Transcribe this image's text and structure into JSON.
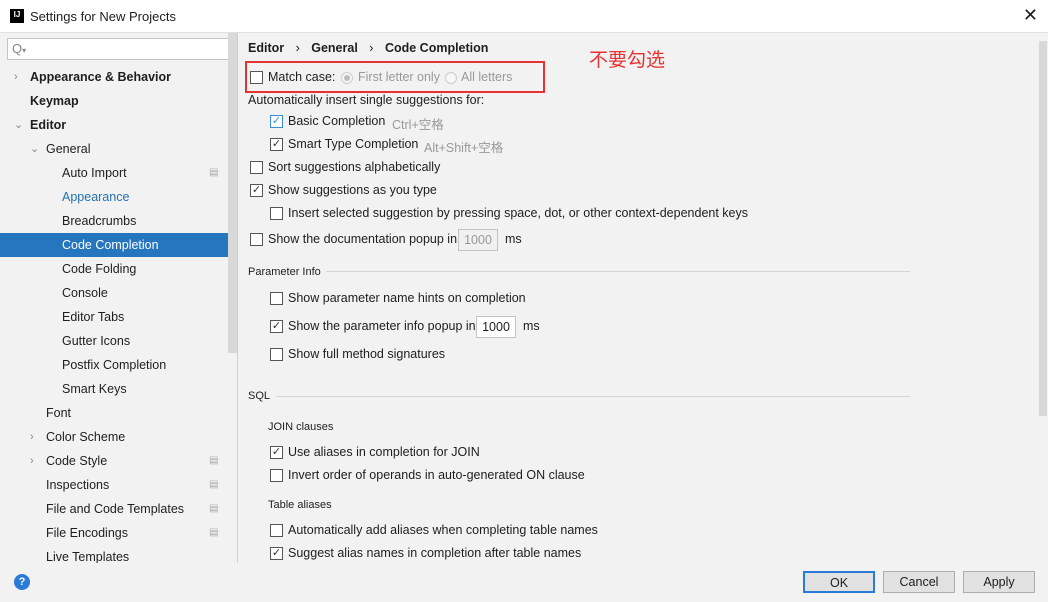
{
  "window": {
    "title": "Settings for New Projects",
    "app_icon": "IJ"
  },
  "sidebar": {
    "search_placeholder": "Q",
    "items": [
      {
        "label": "Appearance & Behavior",
        "bold": true,
        "arrow": "›"
      },
      {
        "label": "Keymap",
        "bold": true
      },
      {
        "label": "Editor",
        "bold": true,
        "arrow": "⌄"
      },
      {
        "label": "General",
        "arrow": "⌄"
      },
      {
        "label": "Auto Import"
      },
      {
        "label": "Appearance"
      },
      {
        "label": "Breadcrumbs"
      },
      {
        "label": "Code Completion",
        "selected": true
      },
      {
        "label": "Code Folding"
      },
      {
        "label": "Console"
      },
      {
        "label": "Editor Tabs"
      },
      {
        "label": "Gutter Icons"
      },
      {
        "label": "Postfix Completion"
      },
      {
        "label": "Smart Keys"
      },
      {
        "label": "Font"
      },
      {
        "label": "Color Scheme",
        "arrow": "›"
      },
      {
        "label": "Code Style",
        "arrow": "›"
      },
      {
        "label": "Inspections"
      },
      {
        "label": "File and Code Templates"
      },
      {
        "label": "File Encodings"
      },
      {
        "label": "Live Templates"
      }
    ]
  },
  "breadcrumb": [
    "Editor",
    "General",
    "Code Completion"
  ],
  "annotation": "不要勾选",
  "colors": {
    "selection": "#2675bf",
    "annotation": "#e53333",
    "link": "#2470b3"
  },
  "options": {
    "match_case": {
      "label": "Match case:",
      "checked": false,
      "radio1": "First letter only",
      "radio2": "All letters"
    },
    "auto_insert": "Automatically insert single suggestions for:",
    "basic": {
      "label": "Basic Completion",
      "shortcut": "Ctrl+空格",
      "checked": true
    },
    "smart": {
      "label": "Smart Type Completion",
      "shortcut": "Alt+Shift+空格",
      "checked": true
    },
    "sort": {
      "label": "Sort suggestions alphabetically",
      "checked": false
    },
    "show_as_type": {
      "label": "Show suggestions as you type",
      "checked": true
    },
    "insert_selected": {
      "label": "Insert selected suggestion by pressing space, dot, or other context-dependent keys",
      "checked": false
    },
    "doc_popup": {
      "label": "Show the documentation popup in",
      "value": "1000",
      "unit": "ms",
      "checked": false
    },
    "param_info": "Parameter Info",
    "param_hints": {
      "label": "Show parameter name hints on completion",
      "checked": false
    },
    "param_popup": {
      "label": "Show the parameter info popup in",
      "value": "1000",
      "unit": "ms",
      "checked": true
    },
    "full_sig": {
      "label": "Show full method signatures",
      "checked": false
    },
    "sql": "SQL",
    "join": "JOIN clauses",
    "use_aliases": {
      "label": "Use aliases in completion for JOIN",
      "checked": true
    },
    "invert": {
      "label": "Invert order of operands in auto-generated ON clause",
      "checked": false
    },
    "table_aliases": "Table aliases",
    "auto_alias": {
      "label": "Automatically add aliases when completing table names",
      "checked": false
    },
    "suggest_alias": {
      "label": "Suggest alias names in completion after table names",
      "checked": true
    }
  },
  "buttons": {
    "ok": "OK",
    "cancel": "Cancel",
    "apply": "Apply",
    "help": "?"
  }
}
